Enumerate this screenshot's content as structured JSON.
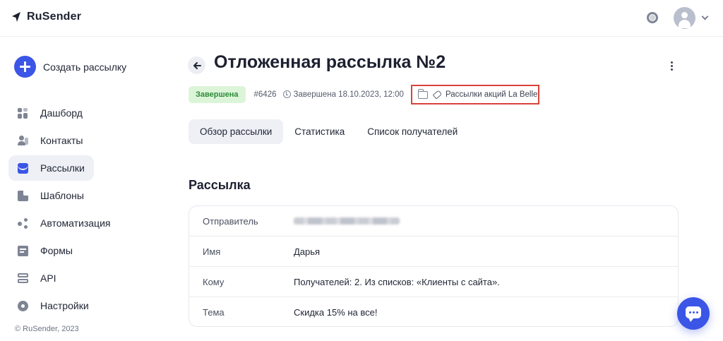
{
  "app": {
    "logo_text": "RuSender",
    "copyright": "© RuSender, 2023"
  },
  "header": {
    "help_icon": "lifebuoy-icon",
    "avatar_icon": "user-avatar-icon",
    "menu_icon": "chevron-down-icon"
  },
  "sidebar": {
    "create_label": "Создать рассылку",
    "items": [
      {
        "label": "Дашборд",
        "icon": "dashboard-icon"
      },
      {
        "label": "Контакты",
        "icon": "contacts-icon"
      },
      {
        "label": "Рассылки",
        "icon": "mailings-icon",
        "active": true
      },
      {
        "label": "Шаблоны",
        "icon": "templates-icon"
      },
      {
        "label": "Автоматизация",
        "icon": "automation-icon"
      },
      {
        "label": "Формы",
        "icon": "forms-icon"
      },
      {
        "label": "API",
        "icon": "api-icon"
      },
      {
        "label": "Настройки",
        "icon": "settings-icon"
      }
    ]
  },
  "campaign": {
    "title": "Отложенная рассылка №2",
    "status": "Завершена",
    "id": "#6426",
    "completed_text": "Завершена 18.10.2023, 12:00",
    "folder": "Рассылки акций La Belle",
    "status_color": "#dcf5d8",
    "highlight_color": "#d9433a"
  },
  "tabs": [
    {
      "label": "Обзор рассылки",
      "active": true
    },
    {
      "label": "Статистика"
    },
    {
      "label": "Список получателей"
    }
  ],
  "section": {
    "title": "Рассылка",
    "rows": [
      {
        "label": "Отправитель",
        "value": ""
      },
      {
        "label": "Имя",
        "value": "Дарья"
      },
      {
        "label": "Кому",
        "value": "Получателей: 2. Из списков: «Клиенты с сайта»."
      },
      {
        "label": "Тема",
        "value": "Скидка 15% на все!"
      }
    ]
  },
  "accent_color": "#3b55e6"
}
